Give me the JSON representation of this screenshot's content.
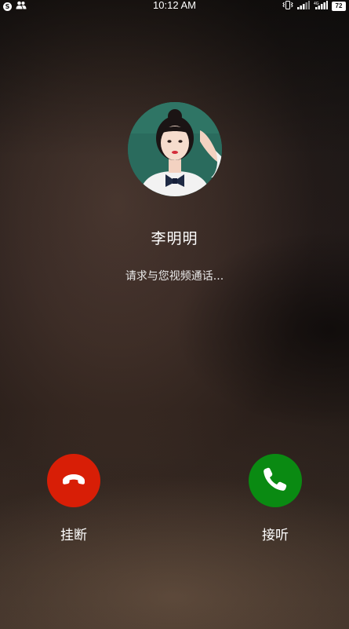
{
  "status_bar": {
    "time": "10:12 AM",
    "left_badge": "S",
    "battery": "72",
    "icons": [
      "s-circle-icon",
      "contacts-icon",
      "vibrate-icon",
      "signal-icon",
      "signal-4g-icon",
      "battery-icon"
    ]
  },
  "call": {
    "caller_name": "李明明",
    "status_text": "请求与您视频通话...",
    "avatar_icon": "avatar-photo"
  },
  "actions": {
    "hangup_label": "挂断",
    "answer_label": "接听",
    "hangup_icon": "phone-hangup-icon",
    "answer_icon": "phone-answer-icon"
  },
  "colors": {
    "hangup": "#d81e06",
    "answer": "#0a8a12"
  }
}
